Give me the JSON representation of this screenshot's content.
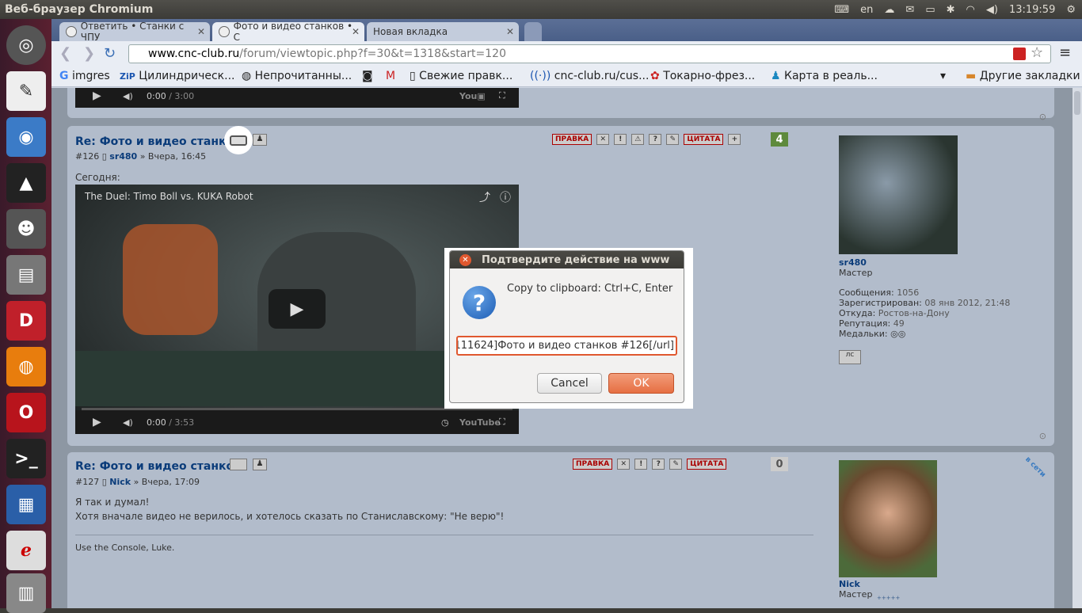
{
  "top_bar": {
    "title": "Веб-браузер Chromium",
    "lang": "en",
    "clock": "13:19:59"
  },
  "tabs": [
    {
      "label": "Ответить • Станки с ЧПУ"
    },
    {
      "label": "Фото и видео станков • С"
    },
    {
      "label": "Новая вкладка"
    }
  ],
  "address": {
    "host": "www.cnc-club.ru",
    "path": "/forum/viewtopic.php?f=30&t=1318&start=120"
  },
  "bookmarks": [
    "imgres",
    "Цилиндрическ...",
    "Непрочитанны...",
    "Свежие правк...",
    "cnc-club.ru/cus...",
    "Токарно-фрез...",
    "Карта в реаль...",
    "Другие закладки"
  ],
  "video_top": {
    "time": "0:00",
    "duration": "/ 3:00"
  },
  "post126": {
    "title": "Re: Фото и видео станков",
    "num": "#126",
    "author": "sr480",
    "date": "» Вчера, 16:45",
    "text": "Сегодня:",
    "count": "4",
    "edit": "ПРАВКА",
    "quote": "ЦИТАТА",
    "video_title": "The Duel: Timo Boll vs. KUKA Robot",
    "video_time": "0:00",
    "video_duration": "/ 3:53",
    "video_brand": "YouTube"
  },
  "profile126": {
    "name": "sr480",
    "rank": "Мастер",
    "posts_label": "Сообщения:",
    "posts": "1056",
    "reg_label": "Зарегистрирован:",
    "reg": "08 янв 2012, 21:48",
    "from_label": "Откуда:",
    "from": "Ростов-на-Дону",
    "rep_label": "Репутация:",
    "rep": "49",
    "medals_label": "Медальки:",
    "pm": "лс"
  },
  "post127": {
    "title": "Re: Фото и видео станков",
    "num": "#127",
    "author": "Nick",
    "date": "» Вчера, 17:09",
    "line1": "Я так и думал!",
    "line2": "Хотя вначале видео не верилось, и хотелось сказать по Станиславскому: \"Не верю\"!",
    "signature": "Use the Console, Luke.",
    "count": "0",
    "edit": "ПРАВКА",
    "quote": "ЦИТАТА",
    "online": "в сети"
  },
  "profile127": {
    "name": "Nick",
    "rank": "Мастер",
    "stars": "+++++"
  },
  "dialog": {
    "title": "Подтвердите действие на www",
    "message": "Copy to clipboard: Ctrl+C, Enter",
    "value": "111624]Фото и видео станков #126[/url]",
    "cancel": "Cancel",
    "ok": "OK"
  }
}
